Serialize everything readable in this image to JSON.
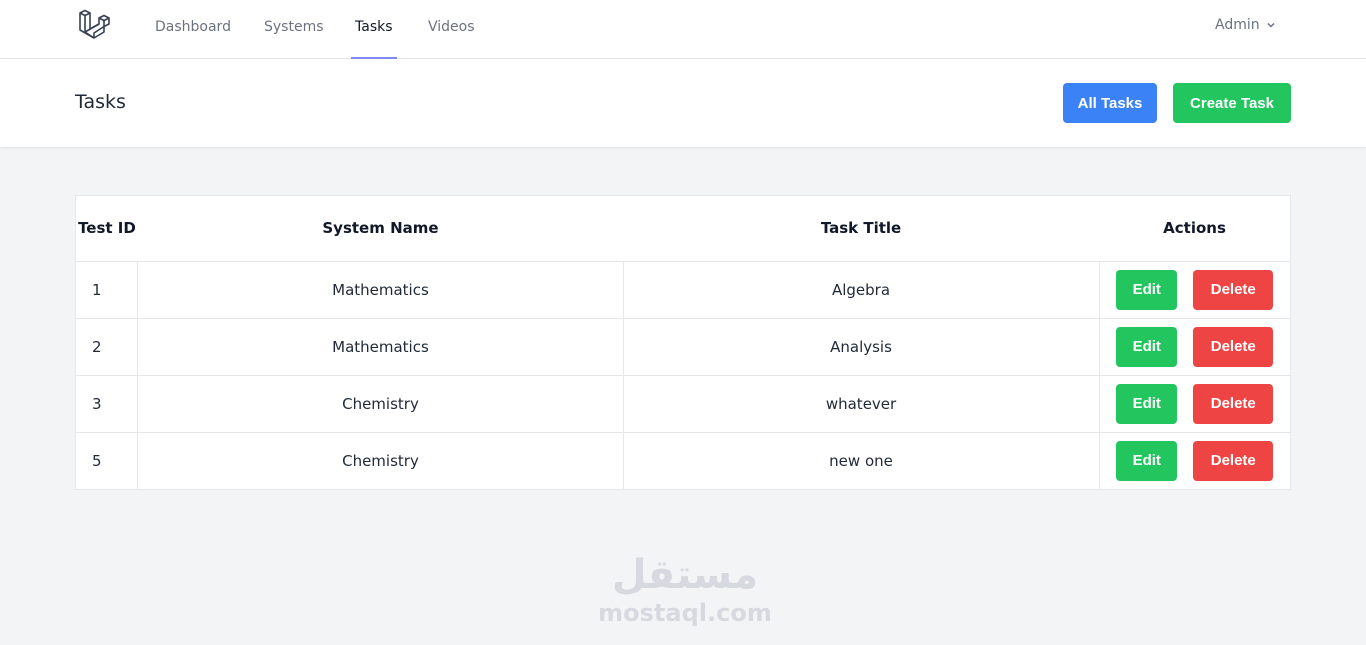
{
  "nav": {
    "links": [
      "Dashboard",
      "Systems",
      "Tasks",
      "Videos"
    ],
    "user": "Admin"
  },
  "header": {
    "title": "Tasks",
    "all_tasks_label": "All Tasks",
    "create_task_label": "Create Task"
  },
  "table": {
    "headers": {
      "id": "Test ID",
      "system": "System Name",
      "title": "Task Title",
      "actions": "Actions"
    },
    "rows": [
      {
        "id": "1",
        "system": "Mathematics",
        "title": "Algebra"
      },
      {
        "id": "2",
        "system": "Mathematics",
        "title": "Analysis"
      },
      {
        "id": "3",
        "system": "Chemistry",
        "title": "whatever"
      },
      {
        "id": "5",
        "system": "Chemistry",
        "title": "new one"
      }
    ],
    "edit_label": "Edit",
    "delete_label": "Delete"
  },
  "watermark": {
    "arabic": "مستقل",
    "latin": "mostaql.com"
  },
  "colors": {
    "primary": "#3b82f6",
    "success": "#22c55e",
    "danger": "#ef4444",
    "active_underline": "#818cf8"
  },
  "icons": {
    "logo": "laravel-logo-icon",
    "user_menu": "chevron-down-icon"
  }
}
